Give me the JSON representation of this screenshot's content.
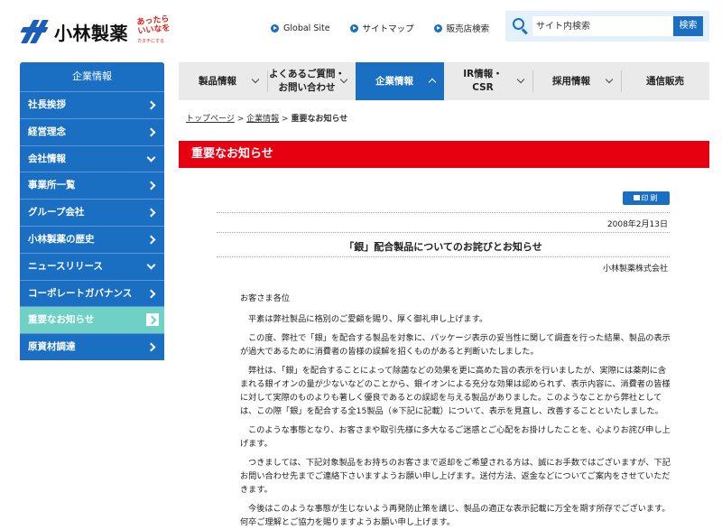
{
  "brand": {
    "logo_text": "小林製薬",
    "slogan_line1": "あったらいいなを",
    "slogan_line2": "カタチにする",
    "colors": {
      "primary": "#1a6fc3",
      "accent_red": "#e60012",
      "active_side": "#6fd0c6"
    }
  },
  "toplinks": [
    {
      "label": "Global Site"
    },
    {
      "label": "サイトマップ"
    },
    {
      "label": "販売店検索"
    }
  ],
  "search": {
    "placeholder": "サイト内検索",
    "button": "検索"
  },
  "gnav": [
    {
      "label": "製品情報",
      "chevron": true
    },
    {
      "label_line1": "よくあるご質問・",
      "label_line2": "お問い合わせ",
      "chevron": true
    },
    {
      "label": "企業情報",
      "chevron": true,
      "active": true
    },
    {
      "label_line1": "IR情報・",
      "label_line2": "CSR",
      "chevron": true
    },
    {
      "label": "採用情報",
      "chevron": true
    },
    {
      "label": "通信販売",
      "chevron": false
    }
  ],
  "sidebar": {
    "heading": "企業情報",
    "items": [
      {
        "label": "社長挨拶",
        "arrow": "right"
      },
      {
        "label": "経営理念",
        "arrow": "right"
      },
      {
        "label": "会社情報",
        "arrow": "down"
      },
      {
        "label": "事業所一覧",
        "arrow": "right"
      },
      {
        "label": "グループ会社",
        "arrow": "right"
      },
      {
        "label": "小林製薬の歴史",
        "arrow": "right"
      },
      {
        "label": "ニュースリリース",
        "arrow": "down"
      },
      {
        "label": "コーポレートガバナンス",
        "arrow": "right"
      },
      {
        "label": "重要なお知らせ",
        "arrow": "right",
        "active": true
      },
      {
        "label": "原資材調達",
        "arrow": "right"
      }
    ]
  },
  "breadcrumb": {
    "items": [
      "トップページ",
      "企業情報"
    ],
    "separator": ">",
    "current": "重要なお知らせ"
  },
  "page_title": "重要なお知らせ",
  "print_button": "印刷",
  "notice": {
    "date": "2008年2月13日",
    "title": "「銀」配合製品についてのお詫びとお知らせ",
    "company": "小林製薬株式会社",
    "greeting": "お客さま各位",
    "paragraphs": [
      "平素は弊社製品に格別のご愛顧を賜り、厚く御礼申し上げます。",
      "この度、弊社で「銀」を配合する製品を対象に、パッケージ表示の妥当性に関して調査を行った結果、製品の表示が過大であるために消費者の皆様の誤解を招くものがあると判断いたしました。",
      "弊社は、「銀」を配合することによって除菌などの効果を更に高めた旨の表示を行いましたが、実際には薬剤に含まれる銀イオンの量が少ないなどのことから、銀イオンによる充分な効果は認められず、表示内容に、消費者の皆様に対して実際のものよりも著しく優良であるとの誤認を与える製品がありました。このようなことから弊社としては、この際「銀」を配合する全15製品（※下記に記載）について、表示を見直し、改善することといたしました。",
      "このような事態となり、お客さまや取引先様に多大なるご迷惑とご心配をお掛けしたことを、心よりお詫び申し上げます。",
      "つきましては、下記対象製品をお持ちのお客さまで返却をご希望される方は、誠にお手数ではございますが、下記お問い合わせ先までご連絡下さいますようお願い申し上げます。送付方法、返金などについてご案内をさせていただきます。",
      "今後はこのような事態が生じないよう再発防止策を講じ、製品の適正な表示記載に万全を期す所存でございます。何卒ご理解とご協力を賜りますようお願い申し上げます。"
    ]
  }
}
